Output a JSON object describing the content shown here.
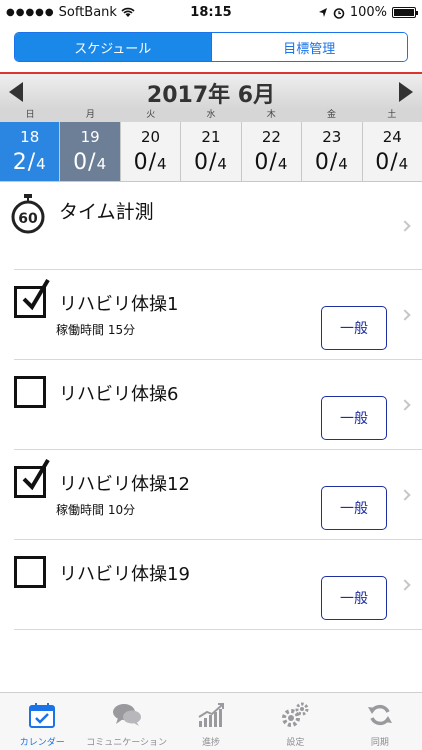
{
  "status_bar": {
    "signal": "●●●●●",
    "carrier": "SoftBank",
    "time": "18:15",
    "battery": "100%"
  },
  "segment": {
    "schedule_label": "スケジュール",
    "goal_label": "目標管理",
    "active": "schedule"
  },
  "calendar": {
    "month_title": "2017年 6月",
    "weekdays": [
      "日",
      "月",
      "火",
      "水",
      "木",
      "金",
      "土"
    ],
    "days": [
      {
        "num": "18",
        "done": "2",
        "total": "4",
        "state": "selected"
      },
      {
        "num": "19",
        "done": "0",
        "total": "4",
        "state": "today"
      },
      {
        "num": "20",
        "done": "0",
        "total": "4",
        "state": "normal"
      },
      {
        "num": "21",
        "done": "0",
        "total": "4",
        "state": "normal"
      },
      {
        "num": "22",
        "done": "0",
        "total": "4",
        "state": "normal"
      },
      {
        "num": "23",
        "done": "0",
        "total": "4",
        "state": "normal"
      },
      {
        "num": "24",
        "done": "0",
        "total": "4",
        "state": "normal"
      }
    ],
    "separator": "/"
  },
  "timer": {
    "icon_number": "60",
    "label": "タイム計測"
  },
  "tasks": [
    {
      "title": "リハビリ体操1",
      "subtitle": "稼働時間 15分",
      "checked": true,
      "button": "一般"
    },
    {
      "title": "リハビリ体操6",
      "subtitle": "",
      "checked": false,
      "button": "一般"
    },
    {
      "title": "リハビリ体操12",
      "subtitle": "稼働時間 10分",
      "checked": true,
      "button": "一般"
    },
    {
      "title": "リハビリ体操19",
      "subtitle": "",
      "checked": false,
      "button": "一般"
    }
  ],
  "tab_bar": {
    "tabs": [
      {
        "label": "カレンダー",
        "icon": "calendar-icon",
        "active": true
      },
      {
        "label": "コミュニケーション",
        "icon": "chat-bubbles-icon",
        "active": false
      },
      {
        "label": "進捗",
        "icon": "progress-chart-icon",
        "active": false
      },
      {
        "label": "設定",
        "icon": "gears-icon",
        "active": false
      },
      {
        "label": "同期",
        "icon": "sync-icon",
        "active": false
      }
    ]
  },
  "colors": {
    "accent": "#1a73e8",
    "selected_day": "#2a86e0",
    "today_day": "#6d7f96",
    "button_border": "#1f2fa0",
    "divider_red": "#dd3333"
  }
}
